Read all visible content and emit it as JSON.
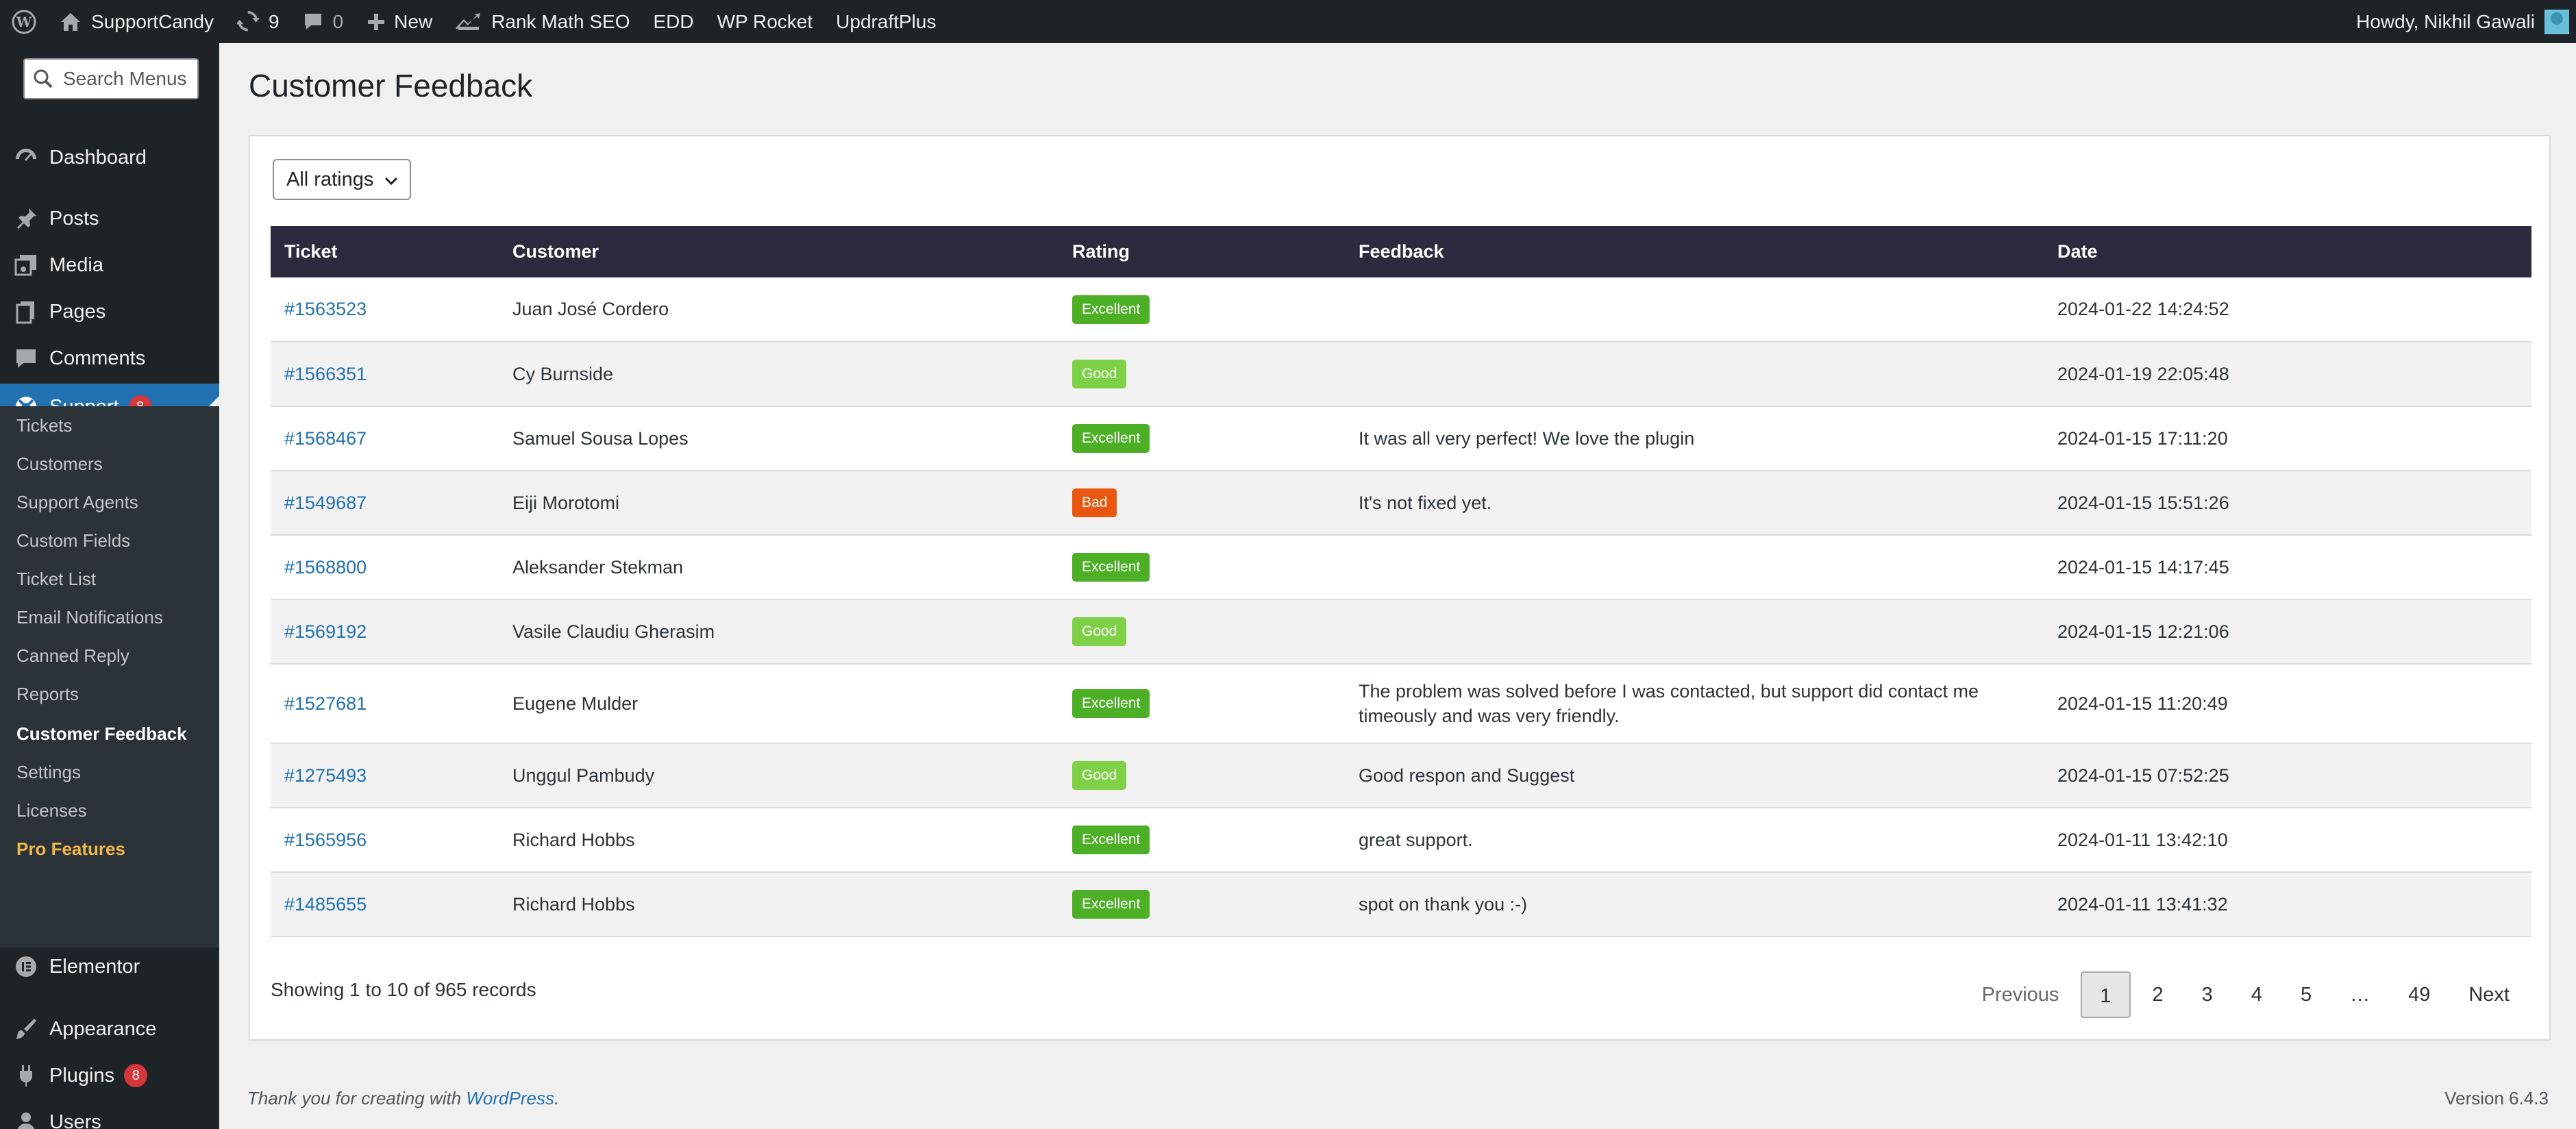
{
  "adminbar": {
    "site_name": "SupportCandy",
    "updates_count": "9",
    "comments_count": "0",
    "new_label": "New",
    "links": [
      "Rank Math SEO",
      "EDD",
      "WP Rocket",
      "UpdraftPlus"
    ],
    "howdy": "Howdy, Nikhil Gawali"
  },
  "sidebar": {
    "search_placeholder": "Search Menus",
    "dashboard": "Dashboard",
    "posts": "Posts",
    "media": "Media",
    "pages": "Pages",
    "comments": "Comments",
    "support": "Support",
    "support_badge": "8",
    "submenu": [
      "Tickets",
      "Customers",
      "Support Agents",
      "Custom Fields",
      "Ticket List",
      "Email Notifications",
      "Canned Reply",
      "Reports",
      "Customer Feedback",
      "Settings",
      "Licenses",
      "Pro Features"
    ],
    "elementor": "Elementor",
    "appearance": "Appearance",
    "plugins": "Plugins",
    "plugins_badge": "8",
    "users": "Users"
  },
  "page": {
    "title": "Customer Feedback",
    "filter_selected": "All ratings"
  },
  "table": {
    "headers": [
      "Ticket",
      "Customer",
      "Rating",
      "Feedback",
      "Date"
    ],
    "rows": [
      {
        "ticket": "#1563523",
        "customer": "Juan José Cordero",
        "rating": "Excellent",
        "feedback": "",
        "date": "2024-01-22 14:24:52"
      },
      {
        "ticket": "#1566351",
        "customer": "Cy Burnside",
        "rating": "Good",
        "feedback": "",
        "date": "2024-01-19 22:05:48"
      },
      {
        "ticket": "#1568467",
        "customer": "Samuel Sousa Lopes",
        "rating": "Excellent",
        "feedback": "It was all very perfect! We love the plugin",
        "date": "2024-01-15 17:11:20"
      },
      {
        "ticket": "#1549687",
        "customer": "Eiji Morotomi",
        "rating": "Bad",
        "feedback": "It's not fixed yet.",
        "date": "2024-01-15 15:51:26"
      },
      {
        "ticket": "#1568800",
        "customer": "Aleksander Stekman",
        "rating": "Excellent",
        "feedback": "",
        "date": "2024-01-15 14:17:45"
      },
      {
        "ticket": "#1569192",
        "customer": "Vasile Claudiu Gherasim",
        "rating": "Good",
        "feedback": "",
        "date": "2024-01-15 12:21:06"
      },
      {
        "ticket": "#1527681",
        "customer": "Eugene Mulder",
        "rating": "Excellent",
        "feedback": "The problem was solved before I was contacted, but support did contact me timeously and was very friendly.",
        "date": "2024-01-15 11:20:49"
      },
      {
        "ticket": "#1275493",
        "customer": "Unggul Pambudy",
        "rating": "Good",
        "feedback": "Good respon and Suggest",
        "date": "2024-01-15 07:52:25"
      },
      {
        "ticket": "#1565956",
        "customer": "Richard Hobbs",
        "rating": "Excellent",
        "feedback": "great support.",
        "date": "2024-01-11 13:42:10"
      },
      {
        "ticket": "#1485655",
        "customer": "Richard Hobbs",
        "rating": "Excellent",
        "feedback": "spot on thank you :-)",
        "date": "2024-01-11 13:41:32"
      }
    ]
  },
  "rating_colors": {
    "Excellent": "#4caf25",
    "Good": "#7ed047",
    "Bad": "#e8560f"
  },
  "pagination": {
    "records_text": "Showing 1 to 10 of 965 records",
    "previous": "Previous",
    "pages": [
      "1",
      "2",
      "3",
      "4",
      "5",
      "…",
      "49"
    ],
    "current": "1",
    "next": "Next"
  },
  "footer": {
    "thanks_prefix": "Thank you for creating with ",
    "wordpress_link": "WordPress",
    "thanks_suffix": ".",
    "version": "Version 6.4.3"
  }
}
